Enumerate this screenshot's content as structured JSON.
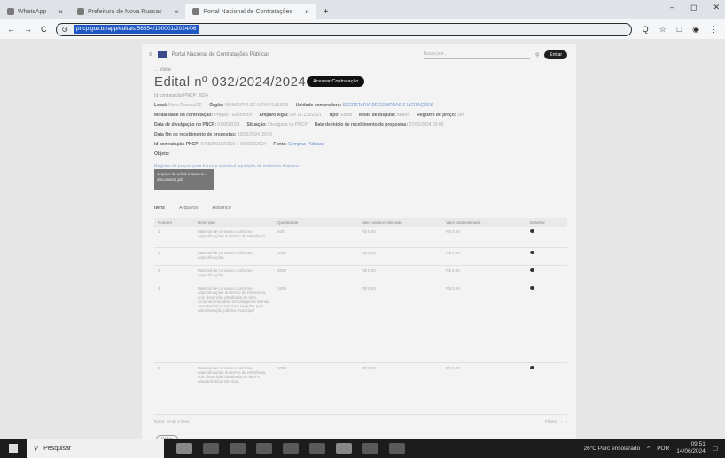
{
  "browser": {
    "tabs": [
      {
        "label": "WhatsApp",
        "close": "×"
      },
      {
        "label": "Prefeitura de Nova Russas",
        "close": "×"
      },
      {
        "label": "Portal Nacional de Contratações",
        "close": "×"
      }
    ],
    "new_tab": "+",
    "window_controls": {
      "minimize": "–",
      "maximize": "◻",
      "close": "✕"
    },
    "nav": {
      "back": "←",
      "forward": "→",
      "reload": "C"
    },
    "url": "pncp.gov.br/app/editais/56854/190001/2024/06",
    "right_icons": [
      "Q",
      "☆",
      "□",
      "◉",
      "⋮"
    ]
  },
  "site": {
    "header": "Portal Nacional de Contratações Públicas",
    "search_placeholder": "Busca por...",
    "login_label": "Entrar",
    "breadcrumb": "← Voltar",
    "title": "Edital nº 032/2024/2024",
    "access_button": "Acessar Contratação",
    "subtitle": "Id contratação PNCP: 2024",
    "meta_rows": [
      [
        {
          "k": "Local:",
          "v": "Nova Russas/CE"
        },
        {
          "k": "Órgão:",
          "v": "MUNICIPIO DE NOVA RUSSAS"
        },
        {
          "k": "Unidade compradora:",
          "v": "SECRETARIA DE COMPRAS E LICITAÇÕES"
        }
      ],
      [
        {
          "k": "Modalidade da contratação:",
          "v": "Pregão - Eletrônico"
        },
        {
          "k": "Amparo legal:",
          "v": "Lei 14.133/2021"
        },
        {
          "k": "Tipo:",
          "v": "Edital"
        },
        {
          "k": "Modo de disputa:",
          "v": "Aberto"
        },
        {
          "k": "Registro de preço:",
          "v": "Sim"
        }
      ],
      [
        {
          "k": "Data de divulgação no PNCP:",
          "v": "07/06/2024"
        },
        {
          "k": "Situação:",
          "v": "Divulgada no PNCP"
        },
        {
          "k": "Data de início de recebimento de propostas:",
          "v": "07/06/2024 09:00"
        }
      ],
      [
        {
          "k": "Data fim de recebimento de propostas:",
          "v": "19/06/2024 09:00"
        }
      ],
      [
        {
          "k": "Id contratação PNCP:",
          "v": "07682001000119-1-000029/2024"
        },
        {
          "k": "Fonte:",
          "v": "Compras Públicas"
        }
      ],
      [
        {
          "k": "Objeto:",
          "v": ""
        }
      ]
    ],
    "object_text": "Registro de preços para futura e eventual aquisição de materiais diversos",
    "file_box": "Arquivo de edital e anexos - documento.pdf",
    "content_tabs": [
      "Itens",
      "Arquivos",
      "Histórico"
    ],
    "table": {
      "headers": [
        "Número",
        "Descrição",
        "Quantidade",
        "Valor unitário estimado",
        "Valor total estimado",
        "Detalhar"
      ],
      "rows": [
        [
          "1",
          "Material de consumo conforme especificações do termo de referência",
          "400",
          "R$ 0,00",
          "R$ 0,00",
          ""
        ],
        [
          "2",
          "Material de consumo conforme especificações",
          "1000",
          "R$ 0,00",
          "R$ 0,00",
          ""
        ],
        [
          "3",
          "Material de consumo conforme especificações",
          "3000",
          "R$ 0,00",
          "R$ 0,00",
          ""
        ],
        [
          "4",
          "Material de consumo conforme especificações do termo de referência, com descrição detalhada do item, incluindo medidas, embalagem e demais características técnicas exigidas pela administração pública municipal",
          "1600",
          "R$ 0,00",
          "R$ 0,00",
          ""
        ],
        [
          "5",
          "Material de consumo conforme especificações do termo de referência, com descrição detalhada do item e características técnicas",
          "2000",
          "R$ 0,00",
          "R$ 0,00",
          ""
        ]
      ]
    },
    "pager": {
      "left": "Exibir: 10 de 5 itens",
      "page": "Página",
      "prev": "‹",
      "next": "›"
    },
    "back_button": "Voltar"
  },
  "taskbar": {
    "search_label": "Pesquisar",
    "weather": "26°C  Parc ensolarado",
    "clock_time": "09:51",
    "clock_date": "14/06/2024",
    "lang": "POR"
  }
}
